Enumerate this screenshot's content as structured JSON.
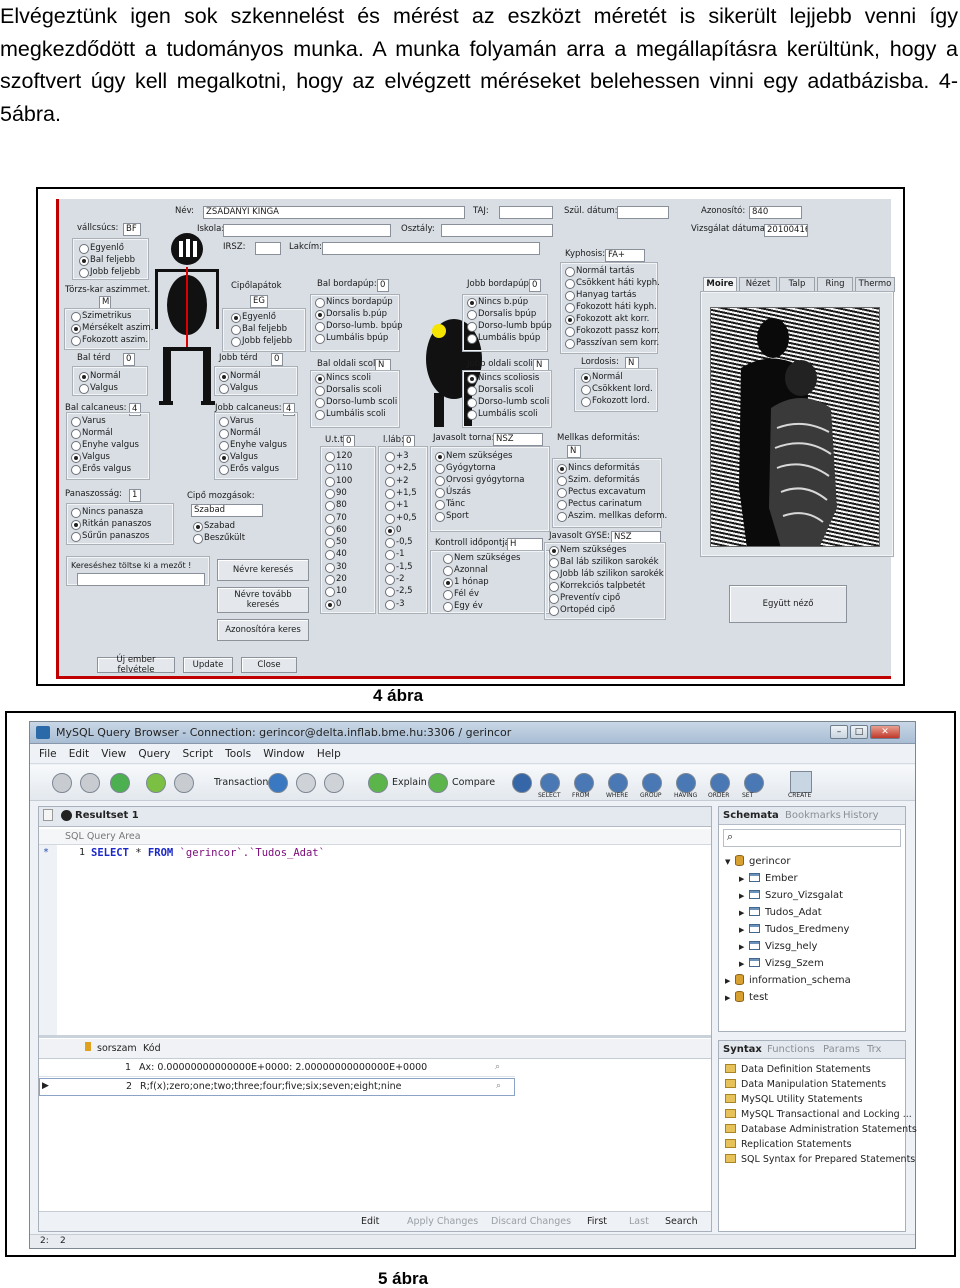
{
  "intro": {
    "text": "Elvégeztünk igen sok szkennelést és mérést az eszközt méretét is sikerült lejjebb venni így megkezdődött a tudományos munka. A munka folyamán arra a megállapításra kerültünk, hogy a szoftvert úgy kell megalkotni, hogy az elvégzett méréseket belehessen vinni egy adatbázisba. 4-5ábra."
  },
  "figure4": {
    "caption": "4 ábra",
    "header": {
      "nev_label": "Név:",
      "nev_value": "ZSADÁNYI KINGA",
      "taj_label": "TAJ:",
      "szul_label": "Szül. dátum:",
      "azon_label": "Azonosító:",
      "azon_value": "840",
      "iskola_label": "Iskola:",
      "osztaly_label": "Osztály:",
      "irsz_label": "IRSZ:",
      "lakcim_label": "Lakcím:",
      "vizsg_label": "Vizsgálat dátuma:",
      "vizsg_value": "20100416"
    },
    "vallcsucs": {
      "label": "vállcsúcs:",
      "value": "BF",
      "options": [
        "Egyenlő",
        "Bal feljebb",
        "Jobb feljebb"
      ],
      "selected": 1
    },
    "torzs": {
      "label": "Törzs-kar aszimmet.",
      "value": "M",
      "options": [
        "Szimetrikus",
        "Mérsékelt aszim.",
        "Fokozott aszim."
      ],
      "selected": 1
    },
    "bal_terd": {
      "label": "Bal térd",
      "value": "0",
      "options": [
        "Normál",
        "Valgus"
      ],
      "selected": 0
    },
    "bal_calc": {
      "label": "Bal calcaneus:",
      "value": "4",
      "options": [
        "Varus",
        "Normál",
        "Enyhe valgus",
        "Valgus",
        "Erős valgus"
      ],
      "selected": 3
    },
    "panasz": {
      "label": "Panaszosság:",
      "value": "1",
      "options": [
        "Nincs panasza",
        "Ritkán panaszos",
        "Sűrűn panaszos"
      ],
      "selected": 1
    },
    "cipo": {
      "label": "Cipőlapátok",
      "value": "EG",
      "options": [
        "Egyenlő",
        "Bal feljebb",
        "Jobb feljebb"
      ],
      "selected": 0
    },
    "jobb_terd": {
      "label": "Jobb térd",
      "value": "0",
      "options": [
        "Normál",
        "Valgus"
      ],
      "selected": 0
    },
    "jobb_calc": {
      "label": "Jobb calcaneus:",
      "value": "4",
      "options": [
        "Varus",
        "Normál",
        "Enyhe valgus",
        "Valgus",
        "Erős valgus"
      ],
      "selected": 3
    },
    "cipo_mozg": {
      "label": "Cipő mozgások:",
      "value": "Szabad",
      "options": [
        "Szabad",
        "Beszűkült"
      ],
      "selected": 0
    },
    "bal_bord": {
      "label": "Bal bordapúp:",
      "value": "0",
      "options": [
        "Nincs bordapúp",
        "Dorsalis b.púp",
        "Dorso-lumb. bpúp",
        "Lumbális bpúp"
      ],
      "selected": 1
    },
    "bal_scoli": {
      "label": "Bal oldali scoli:",
      "value": "N",
      "options": [
        "Nincs scoli",
        "Dorsalis scoli",
        "Dorso-lumb scoli",
        "Lumbális scoli"
      ],
      "selected": 0
    },
    "jobb_bord": {
      "label": "Jobb bordapúp:",
      "value": "0",
      "options": [
        "Nincs b.púp",
        "Dorsalis bpúp",
        "Dorso-lumb bpúp",
        "Lumbális bpúp"
      ],
      "selected": 0
    },
    "jobb_scoli": {
      "label": "Jobb oldali scoli:",
      "value": "N",
      "options": [
        "Nincs scoliosis",
        "Dorsalis scoli",
        "Dorso-lumb scoli",
        "Lumbális scoli"
      ],
      "selected": 0
    },
    "kyphosis": {
      "label": "Kyphosis:",
      "value": "FA+",
      "options": [
        "Normál tartás",
        "Csökkent háti kyph.",
        "Hanyag tartás",
        "Fokozott háti kyph.",
        "Fokozott akt korr.",
        "Fokozott passz korr.",
        "Passzívan sem korr."
      ],
      "selected": 4
    },
    "lordosis": {
      "label": "Lordosis:",
      "value": "N",
      "options": [
        "Normál",
        "Csökkent lord.",
        "Fokozott lord."
      ],
      "selected": 0
    },
    "ut": {
      "label": "U.t.t",
      "value": "0",
      "options": [
        "120",
        "110",
        "100",
        "90",
        "80",
        "70",
        "60",
        "50",
        "40",
        "30",
        "20",
        "10",
        "0"
      ],
      "selected": 12
    },
    "lab": {
      "label": "l.láb:",
      "value": "0",
      "options": [
        "+3",
        "+2,5",
        "+2",
        "+1,5",
        "+1",
        "+0,5",
        "0",
        "-0,5",
        "-1",
        "-1,5",
        "-2",
        "-2,5",
        "-3"
      ],
      "selected": 6
    },
    "torna": {
      "label": "Javasolt torna:",
      "value": "NSZ",
      "options": [
        "Nem szükséges",
        "Gyógytorna",
        "Orvosi gyógytorna",
        "Úszás",
        "Tánc",
        "Sport"
      ],
      "selected": 0
    },
    "kontroll": {
      "label": "Kontroll időpontja:",
      "value": "H",
      "options": [
        "Nem szükséges",
        "Azonnal",
        "1 hónap",
        "Fél év",
        "Egy év"
      ],
      "selected": 2
    },
    "mellkas": {
      "label": "Mellkas deformitás:",
      "value": "N",
      "options": [
        "Nincs deformitás",
        "Szim. deformitás",
        "Pectus excavatum",
        "Pectus carinatum",
        "Aszim. mellkas deform."
      ],
      "selected": 0
    },
    "gyse": {
      "label": "Javasolt GYSE:",
      "value": "NSZ",
      "options": [
        "Nem szükséges",
        "Bal láb szilikon sarokék",
        "Jobb láb szilikon sarokék",
        "Korrekciós talpbetét",
        "Preventív cipő",
        "Ortopéd cipő"
      ],
      "selected": 0
    },
    "tabs": [
      "Moire",
      "Nézet",
      "Talp",
      "Ring",
      "Thermo"
    ],
    "buttons": {
      "search_hint": "Kereséshez töltse ki a mezőt !",
      "nevre": "Névre keresés",
      "nevre_tovabb": "Névre tovább keresés",
      "azonosito": "Azonosítóra keres",
      "uj": "Új ember felvétele",
      "update": "Update",
      "close": "Close",
      "egyutt": "Együtt néző"
    }
  },
  "figure5": {
    "caption": "5 ábra",
    "title": "MySQL Query Browser - Connection: gerincor@delta.inflab.bme.hu:3306 / gerincor",
    "menu": [
      "File",
      "Edit",
      "View",
      "Query",
      "Script",
      "Tools",
      "Window",
      "Help"
    ],
    "toolbar": {
      "transaction": "Transaction",
      "explain": "Explain",
      "compare": "Compare",
      "right_icons": [
        "SELECT",
        "FROM",
        "WHERE",
        "GROUP",
        "HAVING",
        "ORDER",
        "SET"
      ],
      "create": "CREATE"
    },
    "result_tab": "Resultset 1",
    "sql_area_label": "SQL Query Area",
    "query_line": "1",
    "query_marker": "*",
    "query": {
      "kw1": "SELECT",
      "star": "*",
      "kw2": "FROM",
      "target": "`gerincor`.`Tudos_Adat`"
    },
    "grid": {
      "headers": [
        "sorszam",
        "Kód"
      ],
      "rows": [
        {
          "sorszam": "1",
          "kod": "Ax: 0.00000000000000E+0000: 2.00000000000000E+0000"
        },
        {
          "sorszam": "2",
          "kod": "R;f(x);zero;one;two;three;four;five;six;seven;eight;nine"
        }
      ]
    },
    "bottom_bar": [
      "Edit",
      "Apply Changes",
      "Discard Changes",
      "First",
      "Last",
      "Search"
    ],
    "status": {
      "pos": "2:",
      "count": "2"
    },
    "schema_tabs": [
      "Schemata",
      "Bookmarks",
      "History"
    ],
    "schema": {
      "db": "gerincor",
      "tables": [
        "Ember",
        "Szuro_Vizsgalat",
        "Tudos_Adat",
        "Tudos_Eredmeny",
        "Vizsg_hely",
        "Vizsg_Szem"
      ],
      "others": [
        "information_schema",
        "test"
      ]
    },
    "syntax_tabs": [
      "Syntax",
      "Functions",
      "Params",
      "Trx"
    ],
    "syntax_items": [
      "Data Definition Statements",
      "Data Manipulation Statements",
      "MySQL Utility Statements",
      "MySQL Transactional and Locking ...",
      "Database Administration Statements",
      "Replication Statements",
      "SQL Syntax for Prepared Statements"
    ],
    "colors": {
      "keyword": "#1b28c8",
      "ident": "#7a0b7a",
      "title_bg": "#b8cadc"
    }
  }
}
